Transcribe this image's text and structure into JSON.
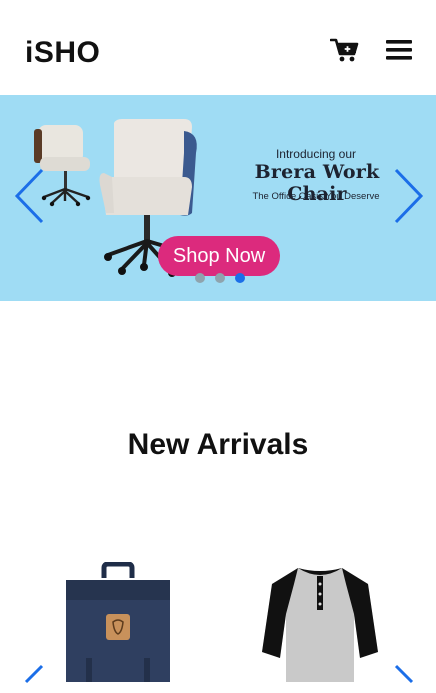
{
  "header": {
    "logo": "iSHO",
    "cart_icon": "cart-icon",
    "menu_icon": "hamburger-menu-icon"
  },
  "banner": {
    "intro": "Introducing our",
    "title": "Brera Work Chair",
    "subtitle": "The Office Oasis You Deserve",
    "cta_label": "Shop Now",
    "background_color": "#9fdcf4",
    "cta_color": "#dc2a7d",
    "arrow_color": "#1b6ee8",
    "slide_count": 3,
    "active_slide": 3
  },
  "new_arrivals": {
    "title": "New Arrivals",
    "products": [
      {
        "image": "navy-backpack"
      },
      {
        "image": "henley-raglan-shirt"
      }
    ]
  }
}
